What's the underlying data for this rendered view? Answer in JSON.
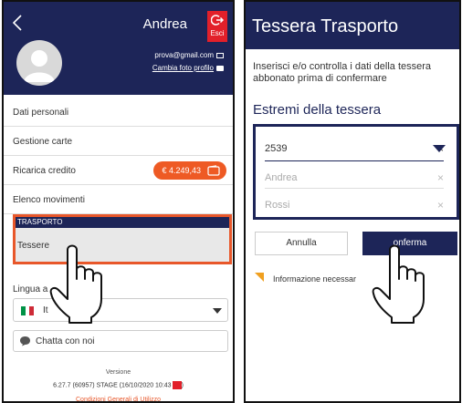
{
  "left_screen": {
    "user_name": "Andrea",
    "exit_label": "Esci",
    "email": "prova@gmail.com",
    "change_photo": "Cambia foto profilo",
    "menu": [
      "Dati personali",
      "Gestione carte",
      "Ricarica credito",
      "Elenco movimenti"
    ],
    "credit_amount": "€ 4.249,43",
    "transport_header": "TRASPORTO",
    "tessere": "Tessere",
    "language_label": "Lingua a",
    "language_value": "It",
    "chat": "Chatta con noi",
    "version_title": "Versione",
    "version": "6.27.7 (60957) STAGE (16/10/2020 10:43",
    "conditions": "Condizioni Generali di Utilizzo"
  },
  "right_screen": {
    "title": "Tessera Trasporto",
    "intro": "Inserisci e/o controlla i dati della tessera abbonato prima di confermare",
    "section": "Estremi della tessera",
    "card_number": "2539",
    "first_name": "Andrea",
    "last_name": "Rossi",
    "cancel": "Annulla",
    "confirm": "onferma",
    "required_info": "Informazione necessar"
  },
  "colors": {
    "navy": "#1d2558",
    "orange": "#e8572a",
    "red": "#e2202a"
  },
  "icons": [
    "back-arrow-icon",
    "logout-icon",
    "avatar-icon",
    "mail-icon",
    "camera-icon",
    "wallet-icon",
    "italy-flag-icon",
    "chevron-down-icon",
    "chat-icon",
    "clear-icon",
    "required-marker-icon",
    "pointing-hand-icon"
  ]
}
